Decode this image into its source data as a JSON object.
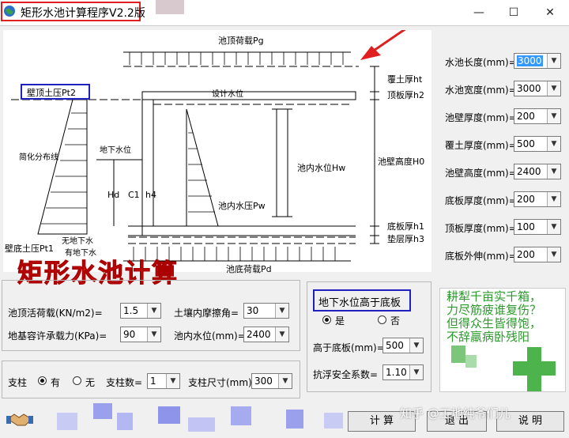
{
  "window": {
    "title": "矩形水池计算程序V2.2版"
  },
  "drawing": {
    "labels": {
      "top_load": "池顶荷载Pg",
      "wall_top_pressure": "壁顶土压Pt2",
      "design_water_level": "设计水位",
      "cover_soil": "覆土厚ht",
      "top_slab": "顶板厚h2",
      "simplified_dist": "简化分布线",
      "groundwater_level": "地下水位",
      "hd": "Hd",
      "c1": "C1",
      "h4": "h4",
      "inner_water_level": "池内水位Hw",
      "wall_height": "池壁高度H0",
      "inner_water_pressure": "池内水压Pw",
      "bottom_slab": "底板厚h1",
      "cushion": "垫层厚h3",
      "wall_bottom_pressure": "壁底土压Pt1",
      "no_groundwater": "无地下水",
      "with_groundwater": "有地下水",
      "bottom_load": "池底荷载Pd"
    },
    "banner": "矩形水池计算"
  },
  "dims": [
    {
      "label": "水池长度(mm)=",
      "value": "3000",
      "selected": true
    },
    {
      "label": "水池宽度(mm)=",
      "value": "3000",
      "selected": false
    },
    {
      "label": "池壁厚度(mm)=",
      "value": "200",
      "selected": false
    },
    {
      "label": "覆土厚度(mm)=",
      "value": "500",
      "selected": false
    },
    {
      "label": "池壁高度(mm)=",
      "value": "2400",
      "selected": false
    },
    {
      "label": "底板厚度(mm)=",
      "value": "200",
      "selected": false
    },
    {
      "label": "顶板厚度(mm)=",
      "value": "100",
      "selected": false
    },
    {
      "label": "底板外伸(mm)=",
      "value": "200",
      "selected": false
    }
  ],
  "loads": {
    "top_live_label": "池顶活荷载(KN/m2)=",
    "top_live_value": "1.5",
    "friction_label": "土壤内摩擦角=",
    "friction_value": "30",
    "bearing_label": "地基容许承载力(KPa)=",
    "bearing_value": "90",
    "inner_water_label": "池内水位(mm)=",
    "inner_water_value": "2400"
  },
  "column": {
    "label": "支柱",
    "yes": "有",
    "no": "无",
    "count_label": "支柱数=",
    "count_value": "1",
    "size_label": "支柱尺寸(mm)",
    "size_value": "300"
  },
  "groundwater": {
    "question": "地下水位高于底板",
    "yes": "是",
    "no": "否",
    "above_label": "高于底板(mm)=",
    "above_value": "500",
    "safety_label": "抗浮安全系数=",
    "safety_value": "1.10"
  },
  "poem": {
    "lines": [
      "耕犁千亩实千箱，",
      "力尽筋疲谁复伤？",
      "但得众生皆得饱，",
      "不辞羸病卧残阳"
    ]
  },
  "buttons": {
    "calculate": "计  算",
    "exit": "退  出",
    "help": "说  明"
  },
  "watermark": "知乎 @工地纯爷们儿",
  "colors": {
    "highlight_box": "#2020c0",
    "title_box": "#e02020",
    "banner_red": "#e01818",
    "arrow_red": "#e02020",
    "poem_green": "#2a9a2a"
  }
}
